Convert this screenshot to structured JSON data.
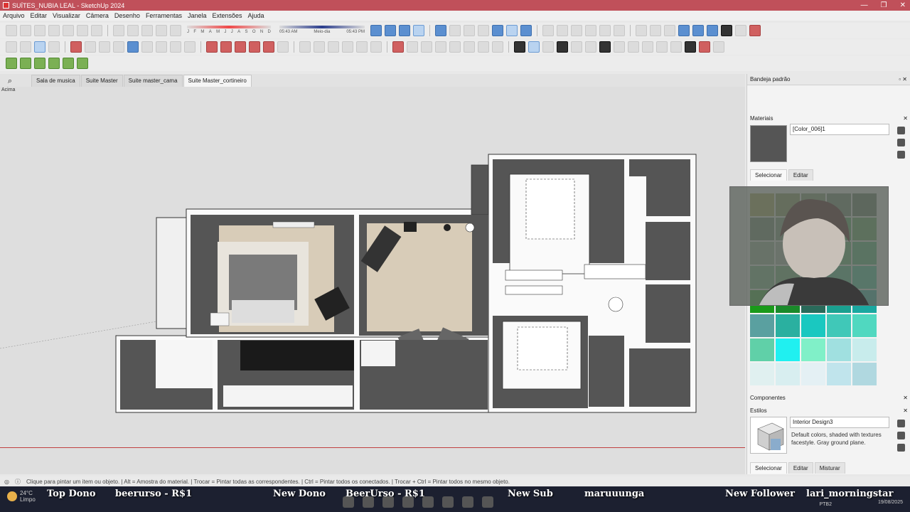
{
  "window": {
    "title": "SUÍTES_NUBIA LEAL - SketchUp 2024",
    "controls": [
      "—",
      "❐",
      "✕"
    ]
  },
  "menu": [
    "Arquivo",
    "Editar",
    "Visualizar",
    "Câmera",
    "Desenho",
    "Ferramentas",
    "Janela",
    "Extensões",
    "Ajuda"
  ],
  "shadows": {
    "months": [
      "J",
      "F",
      "M",
      "A",
      "M",
      "J",
      "J",
      "A",
      "S",
      "O",
      "N",
      "D"
    ],
    "time_start": "05:43 AM",
    "time_mid": "Meio-dia",
    "time_end": "05:43 PM"
  },
  "scenes": {
    "tabs": [
      "Sala de musica",
      "Suite Master",
      "Suite master_cama",
      "Suite Master_cortineiro"
    ],
    "active_index": 3
  },
  "viewport": {
    "view_label": "Acima"
  },
  "tray": {
    "title": "Bandeja padrão",
    "materials": {
      "heading": "Materiais",
      "current_name": "[Color_006]1",
      "current_color": "#555555",
      "tab_select": "Selecionar",
      "tab_edit": "Editar"
    },
    "components_heading": "Componentes",
    "styles": {
      "heading": "Estilos",
      "name": "Interior Design3",
      "description": "Default colors, shaded with textures facestyle. Gray ground plane.",
      "tabs": [
        "Selecionar",
        "Editar",
        "Misturar"
      ]
    },
    "palette_colors": [
      "#a0a040",
      "#7a8a4a",
      "#6c8a5a",
      "#5c7c5c",
      "#4a6a4a",
      "#5c7a5c",
      "#6a8a6a",
      "#4a8a4a",
      "#3a9a4a",
      "#4aa04a",
      "#8aaa8a",
      "#9ab09a",
      "#6aaa6a",
      "#4ab060",
      "#3ab068",
      "#6ab07a",
      "#5aa86a",
      "#4ab07a",
      "#3ab880",
      "#2ac090",
      "#1a9a1a",
      "#1a8a2a",
      "#2a6a5a",
      "#1aa090",
      "#1aa8a0",
      "#5aa0a0",
      "#2ab0a0",
      "#1ac8c0",
      "#40c8b8",
      "#50d8c0",
      "#60d0a8",
      "#20f0f0",
      "#80f0c8",
      "#a0e0e0",
      "#c8ecec",
      "#e0f0f0",
      "#d8eef0",
      "#e4f0f4",
      "#c0e4ec",
      "#b0d8e0"
    ]
  },
  "statusbar": {
    "text": "Clique para pintar um item ou objeto. | Alt = Amostra do material. | Trocar = Pintar todas as correspondentes. | Ctrl = Pintar todos os conectados. | Trocar + Ctrl = Pintar todos no mesmo objeto."
  },
  "taskbar": {
    "weather_temp": "24°C",
    "weather_desc": "Limpo",
    "overlay": {
      "top_label": "Top Dono",
      "top_value": "beerurso - R$1",
      "new_dono_label": "New Dono",
      "new_dono_value": "BeerUrso - R$1",
      "new_sub_label": "New Sub",
      "new_sub_value": "maruuunga",
      "new_follower_label": "New Follower",
      "new_follower_value": "lari_morningstar"
    },
    "lang": "PTB2",
    "date": "19/08/2025"
  }
}
